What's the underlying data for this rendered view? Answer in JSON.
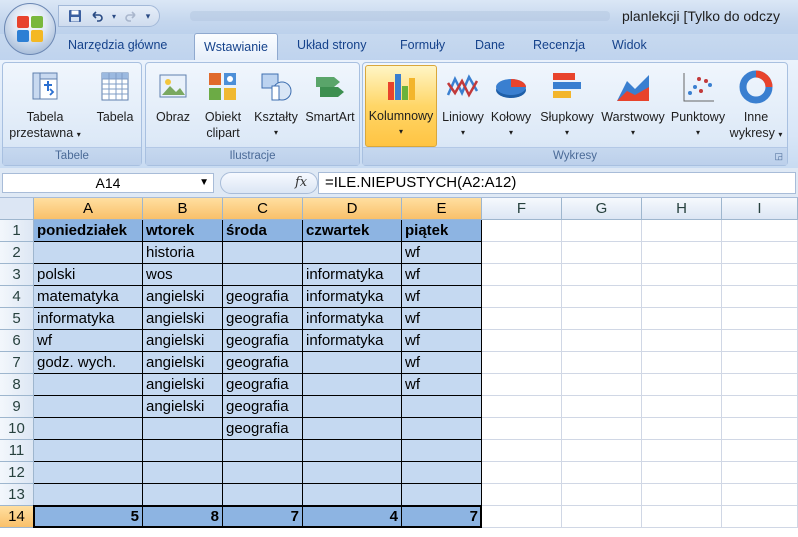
{
  "window": {
    "title": "planlekcji  [Tylko do odczy",
    "qat_icons": [
      "save-icon",
      "undo-icon",
      "redo-icon",
      "customize-icon"
    ]
  },
  "tabs": [
    "Narzędzia główne",
    "Wstawianie",
    "Układ strony",
    "Formuły",
    "Dane",
    "Recenzja",
    "Widok"
  ],
  "active_tab": "Wstawianie",
  "ribbon": {
    "groups": {
      "tabele": "Tabele",
      "ilustracje": "Ilustracje",
      "wykresy": "Wykresy"
    },
    "tabele": {
      "tabela_przestawna_1": "Tabela",
      "tabela_przestawna_2": "przestawna",
      "tabela": "Tabela"
    },
    "ilustracje": {
      "obraz": "Obraz",
      "obiekt_1": "Obiekt",
      "obiekt_2": "clipart",
      "ksztalty": "Kształty",
      "smartart": "SmartArt"
    },
    "wykresy": {
      "kolumnowy": "Kolumnowy",
      "liniowy": "Liniowy",
      "kolowy": "Kołowy",
      "slupkowy": "Słupkowy",
      "warstwowy": "Warstwowy",
      "punktowy": "Punktowy",
      "inne_1": "Inne",
      "inne_2": "wykresy"
    }
  },
  "formula_bar": {
    "name_box": "A14",
    "fx": "fx",
    "formula": "=ILE.NIEPUSTYCH(A2:A12)"
  },
  "sheet": {
    "columns": [
      "A",
      "B",
      "C",
      "D",
      "E",
      "F",
      "G",
      "H",
      "I"
    ],
    "rows": [
      "1",
      "2",
      "3",
      "4",
      "5",
      "6",
      "7",
      "8",
      "9",
      "10",
      "11",
      "12",
      "13",
      "14"
    ],
    "headers": [
      "poniedziałek",
      "wtorek",
      "środa",
      "czwartek",
      "piątek"
    ],
    "body": [
      [
        "",
        "historia",
        "",
        "",
        "wf"
      ],
      [
        "polski",
        "wos",
        "",
        "informatyka",
        "wf"
      ],
      [
        "matematyka",
        "angielski",
        "geografia",
        "informatyka",
        "wf"
      ],
      [
        "informatyka",
        "angielski",
        "geografia",
        "informatyka",
        "wf"
      ],
      [
        "wf",
        "angielski",
        "geografia",
        "informatyka",
        "wf"
      ],
      [
        "godz. wych.",
        "angielski",
        "geografia",
        "",
        "wf"
      ],
      [
        "",
        "angielski",
        "geografia",
        "",
        "wf"
      ],
      [
        "",
        "angielski",
        "geografia",
        "",
        ""
      ],
      [
        "",
        "",
        "geografia",
        "",
        ""
      ],
      [
        "",
        "",
        "",
        "",
        ""
      ],
      [
        "",
        "",
        "",
        "",
        ""
      ],
      [
        "",
        "",
        "",
        "",
        ""
      ]
    ],
    "totals": [
      "5",
      "8",
      "7",
      "4",
      "7"
    ]
  },
  "colors": {
    "header_fill": "#8db4e2",
    "body_fill": "#c5d9f1",
    "ribbon_text": "#15428b",
    "selected_header": "#f9c06a"
  }
}
